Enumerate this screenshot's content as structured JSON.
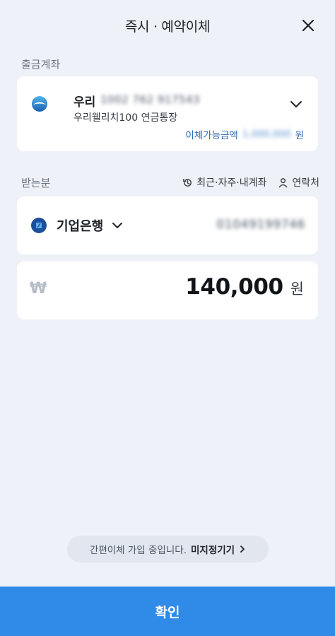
{
  "header": {
    "title": "즉시 · 예약이체"
  },
  "source_section": {
    "label": "출금계좌"
  },
  "source_account": {
    "bank": "우리",
    "number": "1002 762 917543",
    "product": "우리웰리치100 연금통장",
    "balance_label": "이체가능금액",
    "balance_amount": "1,000,000",
    "balance_unit": "원"
  },
  "recipient_section": {
    "label": "받는분",
    "recent_label": "최근·자주·내계좌",
    "contacts_label": "연락처"
  },
  "recipient": {
    "bank": "기업은행",
    "account": "01049199746"
  },
  "amount": {
    "value": "140,000",
    "unit": "원",
    "currency_sign": "₩"
  },
  "notice": {
    "text": "간편이체 가입 중입니다.",
    "action": "미지정기기"
  },
  "confirm": {
    "label": "확인"
  },
  "colors": {
    "primary": "#2f8ae8",
    "background": "#eef1f7",
    "balance_text": "#2d6bb2"
  }
}
